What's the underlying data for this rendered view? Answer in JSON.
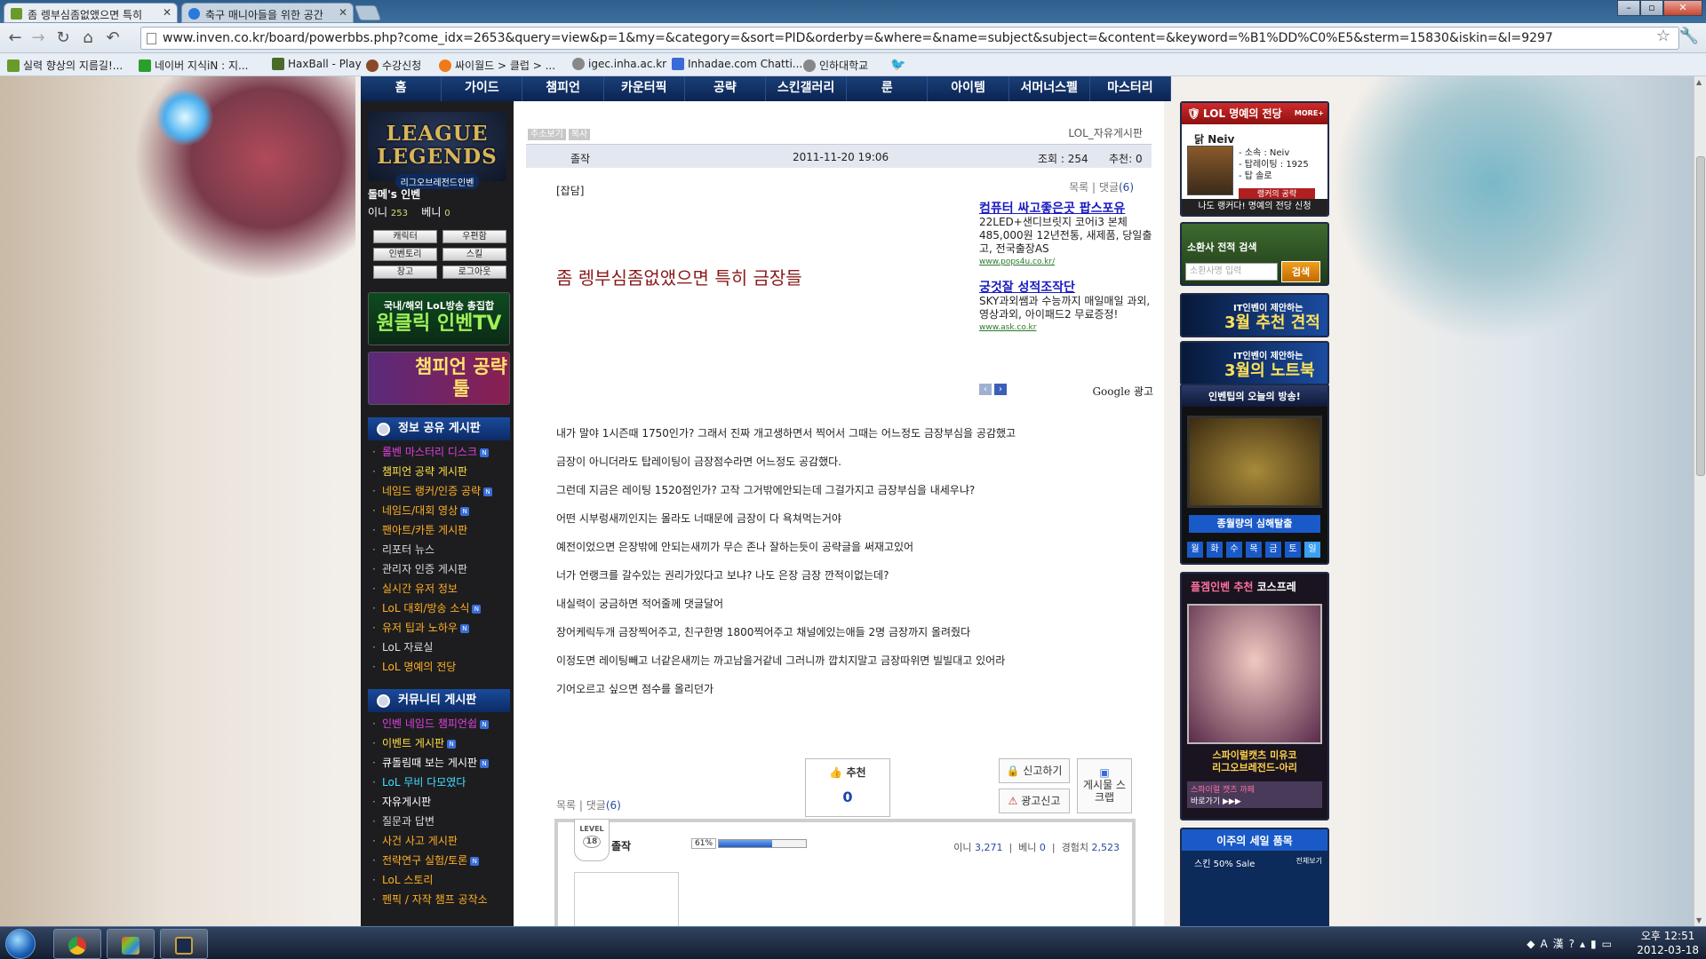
{
  "browser": {
    "tabs": [
      {
        "title": "좀 렝부심좀없앴으면 특히",
        "active": true
      },
      {
        "title": "축구 매니아들을 위한 공간",
        "active": false
      }
    ],
    "url": "www.inven.co.kr/board/powerbbs.php?come_idx=2653&query=view&p=1&my=&category=&sort=PID&orderby=&where=&name=subject&subject=&content=&keyword=%B1%DD%C0%E5&sterm=15830&iskin=&l=9297",
    "bookmarks": [
      "실력 향상의 지름길!...",
      "네이버 지식iN : 지...",
      "HaxBall - Play",
      "수강신청",
      "싸이월드 > 클럽 > ...",
      "igec.inha.ac.kr",
      "Inhadae.com Chatti...",
      "인하대학교"
    ]
  },
  "site_nav": [
    "홈",
    "가이드",
    "챔피언",
    "카운터픽",
    "공략",
    "스킨갤러리",
    "룬",
    "아이템",
    "서머너스펠",
    "마스터리"
  ],
  "left": {
    "logo_line1": "LEAGUE",
    "logo_line2": "LEGENDS",
    "logo_sub": "리그오브레전드인벤",
    "user_name": "돌메's 인벤",
    "inni_label": "이니",
    "inni_value": "253",
    "benni_label": "베니",
    "benni_value": "0",
    "buttons": [
      "캐릭터",
      "우편함",
      "인벤토리",
      "스킬",
      "창고",
      "로그아웃"
    ],
    "banner1_top": "국내/해외 LoL방송 총집합",
    "banner1_main": "원클릭 인벤TV",
    "banner2_main": "챔피언 공략툴",
    "section1": "정보 공유 게시판",
    "menu1": [
      {
        "label": "롤벤 마스터리 디스크",
        "color": "#e040e0",
        "new": true
      },
      {
        "label": "챔피언 공략 게시판",
        "color": "#ffe040",
        "new": false
      },
      {
        "label": "네임드 랭커/인증 공략",
        "color": "#ffb020",
        "new": true
      },
      {
        "label": "네임드/대회 영상",
        "color": "#ffb020",
        "new": true
      },
      {
        "label": "팬아트/카툰 게시판",
        "color": "#ffb020",
        "new": false
      },
      {
        "label": "리포터 뉴스",
        "color": "#dddddd",
        "new": false
      },
      {
        "label": "관리자 인증 게시판",
        "color": "#dddddd",
        "new": false
      },
      {
        "label": "실시간 유저 정보",
        "color": "#ffb020",
        "new": false
      },
      {
        "label": "LoL 대회/방송 소식",
        "color": "#ffb020",
        "new": true
      },
      {
        "label": "유저 팁과 노하우",
        "color": "#ffb020",
        "new": true
      },
      {
        "label": "LoL 자료실",
        "color": "#dddddd",
        "new": false
      },
      {
        "label": "LoL 명예의 전당",
        "color": "#ffb020",
        "new": false
      }
    ],
    "section2": "커뮤니티 게시판",
    "menu2": [
      {
        "label": "인벤 네임드 챔피언쉽",
        "color": "#e040e0",
        "new": true
      },
      {
        "label": "이벤트 게시판",
        "color": "#ffe040",
        "new": true
      },
      {
        "label": "큐돌림때 보는 게시판",
        "color": "#ffffff",
        "new": true
      },
      {
        "label": "LoL 무비 다모였다",
        "color": "#40e0ff",
        "new": false
      },
      {
        "label": "자유게시판",
        "color": "#ffffff",
        "new": false
      },
      {
        "label": "질문과 답변",
        "color": "#dddddd",
        "new": false
      },
      {
        "label": "사건 사고 게시판",
        "color": "#ffb020",
        "new": false
      },
      {
        "label": "전략연구 실험/토론",
        "color": "#ffb020",
        "new": true
      },
      {
        "label": "LoL 스토리",
        "color": "#ffb020",
        "new": false
      },
      {
        "label": "펜픽 / 자작 챔프 공작소",
        "color": "#ffb020",
        "new": false
      }
    ]
  },
  "post": {
    "btn_address": "주소보기",
    "btn_copy": "복사",
    "board": "LOL_자유게시판",
    "author": "졸작",
    "date": "2011-11-20 19:06",
    "views_label": "조회 : 254",
    "rec_label": "추천: 0",
    "category": "[잡담]",
    "list": "목록",
    "comments_label": "댓글",
    "comments_count": "(6)",
    "title": "좀 렝부심좀없앴으면 특히 금장들",
    "body": [
      "내가 말야 1시즌때 1750인가? 그래서 진짜 개고생하면서 찍어서 그때는 어느정도 금장부심을 공감했고",
      "금장이 아니더라도 탑레이팅이 금장점수라면 어느정도 공감했다.",
      "그런데 지금은 레이팅 1520점인가?  고작 그거밖에안되는데 그걸가지고 금장부심을 내세우냐?",
      "어떤 시부렁새끼인지는 몰라도 너때문에 금장이 다 욕쳐먹는거야",
      "예전이었으면 은장밖에 안되는새끼가 무슨 존나 잘하는듯이 공략글을 써재고있어",
      "너가 언랭크를 갈수있는 권리가있다고 보냐? 나도 은장 금장 깐적이없는데?",
      "내실력이 궁금하면 적어줄께 댓글달어",
      "장어케릭두개 금장찍어주고, 친구한명 1800찍어주고 채널에있는애들 2명 금장까지 올려줬다",
      "이정도면 레이팅빼고 너같은새끼는 까고남을거같네 그러니까 깝치지말고 금장따위면 빌빌대고 있어라",
      "기어오르고 싶으면 점수를 올리던가"
    ],
    "recommend_label": "추천",
    "recommend_value": "0",
    "report": "신고하기",
    "ad_report": "광고신고",
    "scrap": "게시물 스크랩",
    "profile": {
      "level_label": "LEVEL",
      "level": "18",
      "name": "졸작",
      "exp_pct": "61%",
      "exp_fraction": 0.61,
      "inni": "3,271",
      "benni": "0",
      "exp": "2,523",
      "inni_label": "이니",
      "benni_label": "베니",
      "exp_label": "경험치"
    }
  },
  "ads": [
    {
      "headline": "컴퓨터 싸고좋은곳 팝스포유",
      "text": "22LED+샌디브릿지 코어i3 본체 485,000원 12년전통, 새제품, 당일출고, 전국출장AS",
      "url": "www.pops4u.co.kr/"
    },
    {
      "headline": "궁것잘 성적조작단",
      "text": "SKY과외쌤과 수능까지 매일매일 과외, 영상과외, 아이패드2 무료증정!",
      "url": "www.ask.co.kr"
    }
  ],
  "google_ad": "Google 광고",
  "right": {
    "hof_title": "LOL 명예의 전당",
    "hof_more": "MORE+",
    "hof_user": "닭 Neiv",
    "hof_info": [
      "- 소속 : Neiv",
      "- 탑레이팅 : 1925",
      "- 탑 솔로"
    ],
    "hof_btn": "랭커의 공략",
    "hof_foot": "나도 랭커다! 명예의 전당 신청",
    "search_title": "소환사 전적 검색",
    "search_placeholder": "소환사명 입력",
    "search_btn": "검색",
    "it1_top": "IT인벤이 제안하는",
    "it1_main": "3월 추천 견적",
    "it2_top": "IT인벤이 제안하는",
    "it2_main": "3월의 노트북",
    "broad_title": "인벤팁의 오늘의 방송!",
    "broad_caption": "종월량의 심해탈출",
    "days": [
      "월",
      "화",
      "수",
      "목",
      "금",
      "토",
      "일"
    ],
    "cos_title_a": "플겜인벤 추천",
    "cos_title_b": "코스프레",
    "cos_cap1": "스파이럴캣츠 미유코",
    "cos_cap2": "리그오브레전드-아리",
    "cos_link1": "스파이럴 캣츠 까페",
    "cos_link2": "바로가기 ▶▶▶",
    "weekly_title": "이주의 세일 품목",
    "weekly_sub": "스킨 50% Sale",
    "weekly_all": "전체보기"
  },
  "taskbar": {
    "time": "오후 12:51",
    "date": "2012-03-18"
  }
}
